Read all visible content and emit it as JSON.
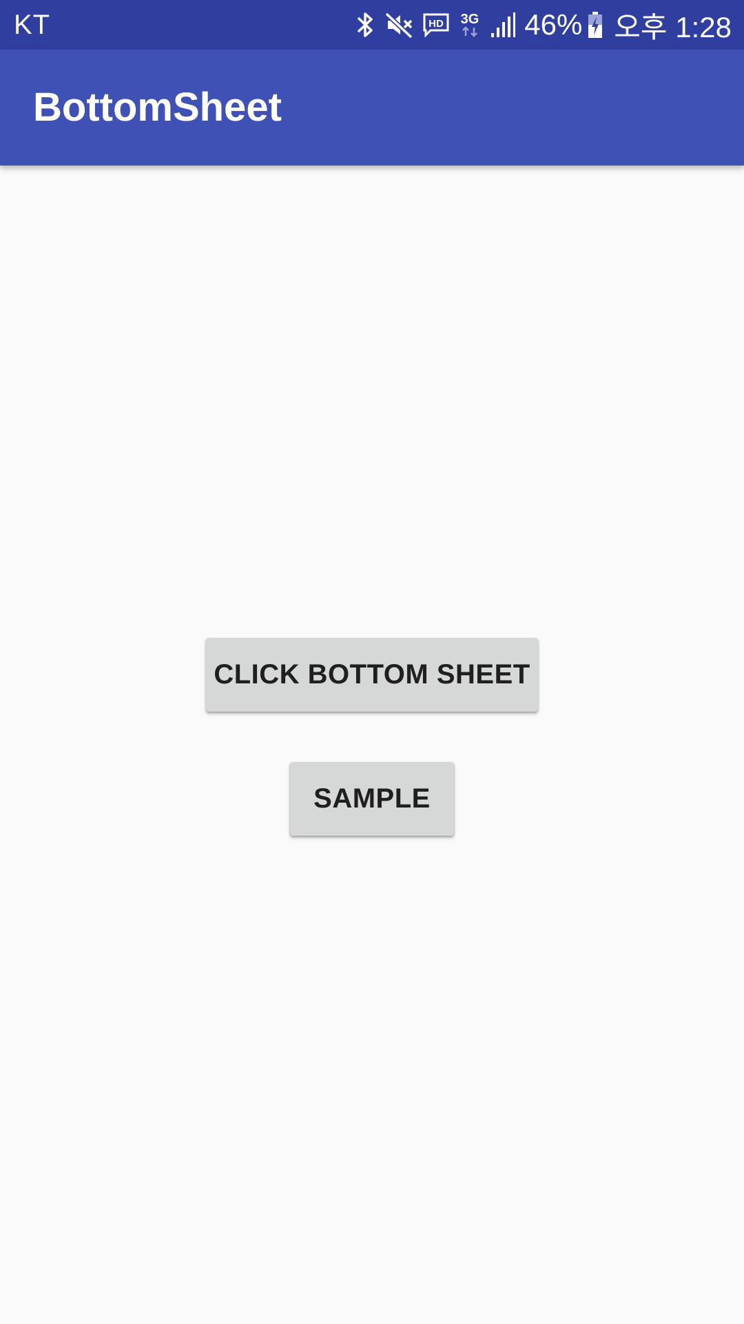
{
  "status_bar": {
    "carrier": "KT",
    "battery_percent": "46%",
    "time": "오후 1:28",
    "network_type": "3G",
    "hd_label": "HD",
    "icons": [
      "bluetooth-icon",
      "mute-vibrate-icon",
      "hd-voice-icon",
      "3g-data-icon",
      "signal-icon",
      "battery-charging-icon"
    ]
  },
  "app_bar": {
    "title": "BottomSheet"
  },
  "main": {
    "bottom_sheet_button_label": "CLICK BOTTOM SHEET",
    "sample_button_label": "SAMPLE"
  },
  "colors": {
    "status_bar": "#303f9f",
    "app_bar": "#3f51b5",
    "background": "#fafafa",
    "button": "#d6d7d7"
  }
}
